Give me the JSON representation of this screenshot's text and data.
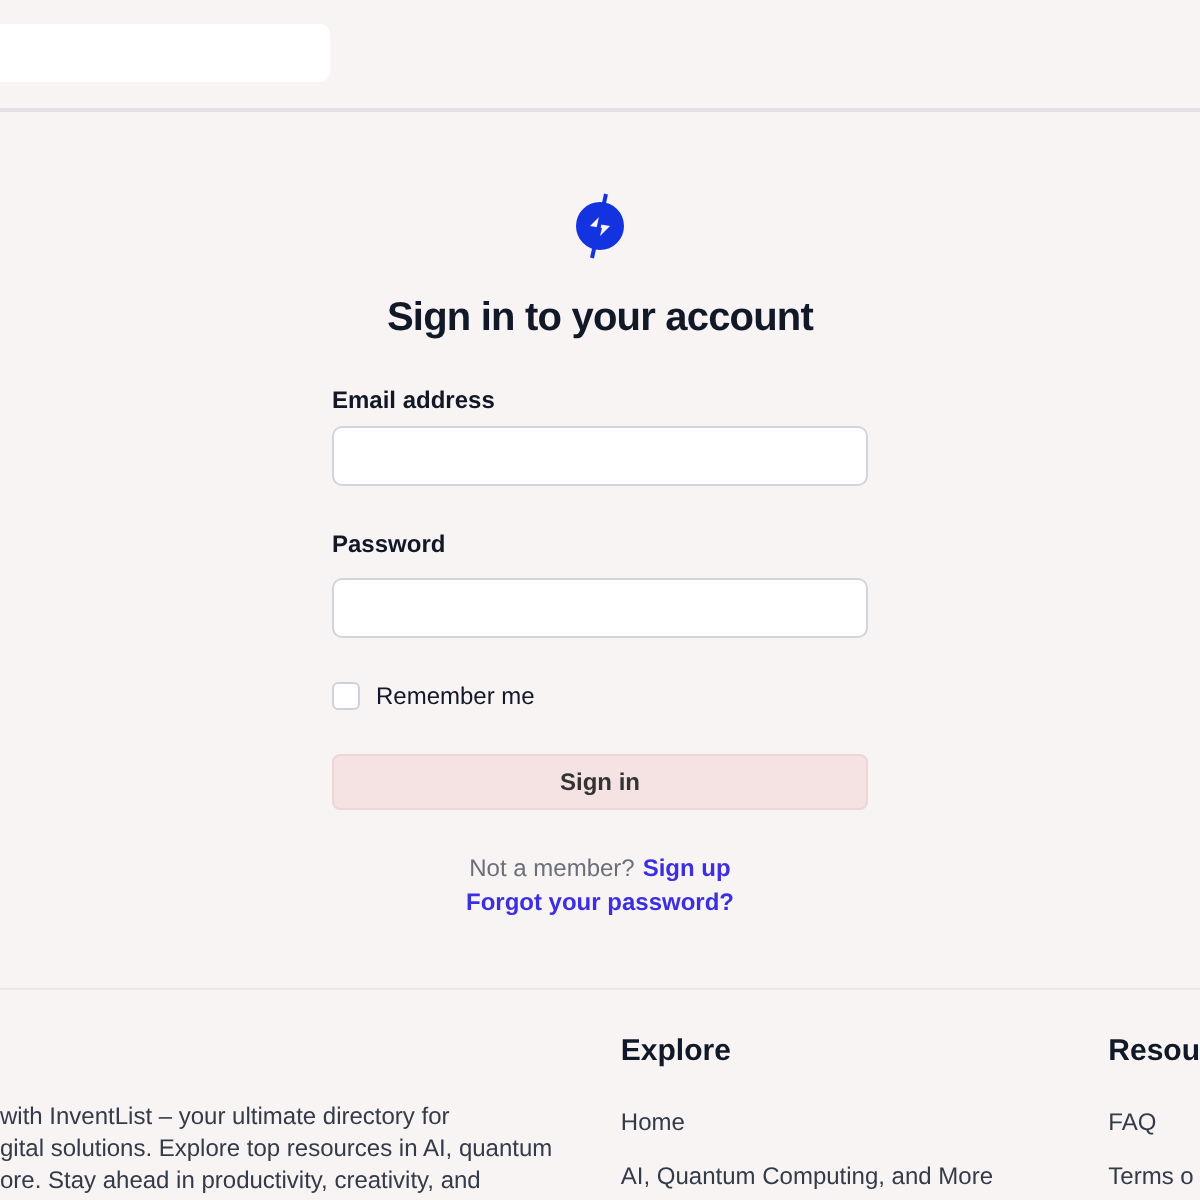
{
  "header": {
    "search": {
      "kind": "field"
    }
  },
  "signin": {
    "title": "Sign in to your account",
    "fields": [
      {
        "label": "Email address"
      },
      {
        "label": "Password"
      }
    ],
    "remember": {
      "label": "Remember me",
      "checked": false
    },
    "button": "Sign in",
    "signup_prompt": "Not a member?",
    "signup_link": "Sign up",
    "forgot_link": "Forgot your password?"
  },
  "footer": {
    "about_lines": [
      " with InventList – your ultimate directory for",
      "gital solutions. Explore top resources in AI, quantum",
      "ore. Stay ahead in productivity, creativity, and"
    ],
    "columns": [
      {
        "title": "Explore",
        "links": [
          "Home",
          "AI, Quantum Computing, and More"
        ]
      },
      {
        "title": "Resou",
        "links": [
          "FAQ",
          "Terms o"
        ]
      }
    ]
  }
}
